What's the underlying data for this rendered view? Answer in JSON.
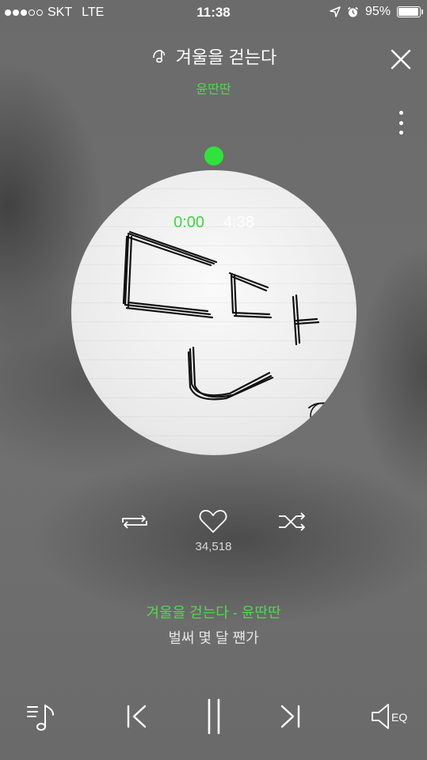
{
  "status_bar": {
    "carrier": "SKT",
    "network": "LTE",
    "time": "11:38",
    "battery": "95%",
    "signal_bars_filled": 3,
    "signal_bars_total": 5
  },
  "header": {
    "title": "겨울을 걷는다",
    "artist": "윤딴딴",
    "title_icon": "music-note-icon",
    "close_icon": "close-icon",
    "more_icon": "more-vertical-icon"
  },
  "player": {
    "elapsed": "0:00",
    "duration": "4:38",
    "progress": 0.0,
    "accent_color": "#2fe33a"
  },
  "actions": {
    "repeat_icon": "repeat-icon",
    "like_icon": "heart-icon",
    "like_count": "34,518",
    "shuffle_icon": "shuffle-icon"
  },
  "lyrics": {
    "current": "겨울을 걷는다 - 윤딴딴",
    "next": "벌써 몇 달 쨴가"
  },
  "controls": {
    "playlist_icon": "playlist-icon",
    "prev_icon": "previous-track-icon",
    "pause_icon": "pause-icon",
    "next_icon": "next-track-icon",
    "eq_label": "EQ"
  }
}
